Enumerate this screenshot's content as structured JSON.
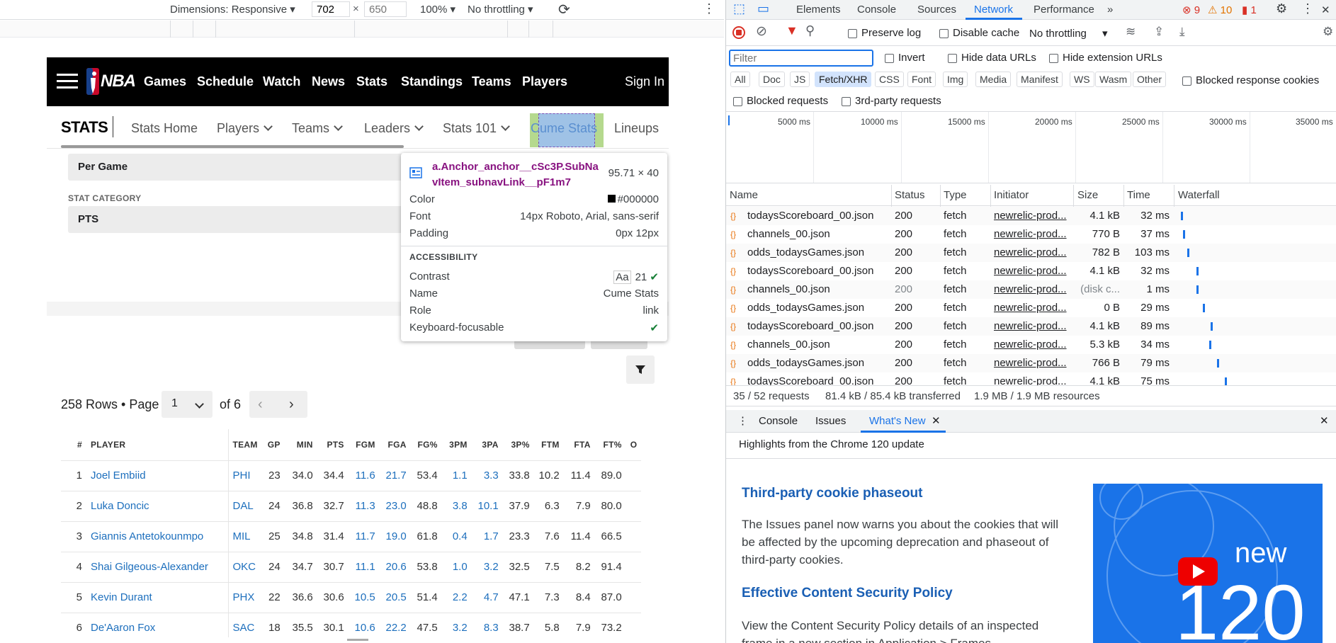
{
  "device_toolbar": {
    "dimensions_label": "Dimensions: Responsive",
    "width": "702",
    "height_placeholder": "650",
    "times": "×",
    "zoom": "100%",
    "throttling": "No throttling"
  },
  "nba": {
    "logo_text": "NBA",
    "nav": [
      "Games",
      "Schedule",
      "Watch",
      "News",
      "Stats",
      "Standings",
      "Teams",
      "Players"
    ],
    "sign_in": "Sign In",
    "stats_label": "STATS",
    "stats_nav": [
      "Stats Home",
      "Players",
      "Teams",
      "Leaders",
      "Stats 101",
      "Cume Stats",
      "Lineups"
    ],
    "per_game": "Per Game",
    "stat_category_label": "STAT CATEGORY",
    "stat_category_value": "PTS",
    "pager": {
      "rows": "258 Rows • Page",
      "page": "1",
      "of": "of 6"
    },
    "table_headers": [
      "#",
      "PLAYER",
      "TEAM",
      "GP",
      "MIN",
      "PTS",
      "FGM",
      "FGA",
      "FG%",
      "3PM",
      "3PA",
      "3P%",
      "FTM",
      "FTA",
      "FT%",
      "O"
    ],
    "rows": [
      [
        "1",
        "Joel Embiid",
        "PHI",
        "23",
        "34.0",
        "34.4",
        "11.6",
        "21.7",
        "53.4",
        "1.1",
        "3.3",
        "33.8",
        "10.2",
        "11.4",
        "89.0"
      ],
      [
        "2",
        "Luka Doncic",
        "DAL",
        "24",
        "36.8",
        "32.7",
        "11.3",
        "23.0",
        "48.8",
        "3.8",
        "10.1",
        "37.9",
        "6.3",
        "7.9",
        "80.0"
      ],
      [
        "3",
        "Giannis Antetokounmpo",
        "MIL",
        "25",
        "34.8",
        "31.4",
        "11.7",
        "19.0",
        "61.8",
        "0.4",
        "1.7",
        "23.3",
        "7.6",
        "11.4",
        "66.5"
      ],
      [
        "4",
        "Shai Gilgeous-Alexander",
        "OKC",
        "24",
        "34.7",
        "30.7",
        "11.1",
        "20.6",
        "53.8",
        "1.0",
        "3.2",
        "32.5",
        "7.5",
        "8.2",
        "91.4"
      ],
      [
        "5",
        "Kevin Durant",
        "PHX",
        "22",
        "36.6",
        "30.6",
        "10.5",
        "20.5",
        "51.4",
        "2.2",
        "4.7",
        "47.1",
        "7.3",
        "8.4",
        "87.0"
      ],
      [
        "6",
        "De'Aaron Fox",
        "SAC",
        "18",
        "35.5",
        "30.1",
        "10.6",
        "22.2",
        "47.5",
        "3.2",
        "8.3",
        "38.7",
        "5.8",
        "7.9",
        "73.2"
      ]
    ]
  },
  "tooltip": {
    "selector": "a.Anchor_anchor__cSc3P.SubNavItem_subnavLink__pF1m7",
    "size": "95.71 × 40",
    "color_label": "Color",
    "color_value": "#000000",
    "font_label": "Font",
    "font_value": "14px Roboto, Arial, sans-serif",
    "padding_label": "Padding",
    "padding_value": "0px 12px",
    "accessibility": "ACCESSIBILITY",
    "contrast_label": "Contrast",
    "contrast_aa": "Aa",
    "contrast_value": "21",
    "name_label": "Name",
    "name_value": "Cume Stats",
    "role_label": "Role",
    "role_value": "link",
    "kbd_label": "Keyboard-focusable"
  },
  "devtools": {
    "tabs": [
      "Elements",
      "Console",
      "Sources",
      "Network",
      "Performance"
    ],
    "errors": "9",
    "warnings": "10",
    "issues": "1",
    "preserve_log": "Preserve log",
    "disable_cache": "Disable cache",
    "throttling": "No throttling",
    "filter_placeholder": "Filter",
    "invert": "Invert",
    "hide_data_urls": "Hide data URLs",
    "hide_ext_urls": "Hide extension URLs",
    "chips": [
      "All",
      "Doc",
      "JS",
      "Fetch/XHR",
      "CSS",
      "Font",
      "Img",
      "Media",
      "Manifest",
      "WS",
      "Wasm",
      "Other"
    ],
    "blocked_cookies": "Blocked response cookies",
    "blocked_requests": "Blocked requests",
    "third_party": "3rd-party requests",
    "timeline": [
      "5000 ms",
      "10000 ms",
      "15000 ms",
      "20000 ms",
      "25000 ms",
      "30000 ms",
      "35000 ms"
    ],
    "columns": [
      "Name",
      "Status",
      "Type",
      "Initiator",
      "Size",
      "Time",
      "Waterfall"
    ],
    "requests": [
      {
        "name": "todaysScoreboard_00.json",
        "status": "200",
        "type": "fetch",
        "initiator": "newrelic-prod...",
        "size": "4.1 kB",
        "time": "32 ms",
        "wf": 0.02
      },
      {
        "name": "channels_00.json",
        "status": "200",
        "type": "fetch",
        "initiator": "newrelic-prod...",
        "size": "770 B",
        "time": "37 ms",
        "wf": 0.03
      },
      {
        "name": "odds_todaysGames.json",
        "status": "200",
        "type": "fetch",
        "initiator": "newrelic-prod...",
        "size": "782 B",
        "time": "103 ms",
        "wf": 0.06
      },
      {
        "name": "todaysScoreboard_00.json",
        "status": "200",
        "type": "fetch",
        "initiator": "newrelic-prod...",
        "size": "4.1 kB",
        "time": "32 ms",
        "wf": 0.12
      },
      {
        "name": "channels_00.json",
        "status": "200",
        "type": "fetch",
        "initiator": "newrelic-prod...",
        "size": "(disk c...",
        "time": "1 ms",
        "wf": 0.12
      },
      {
        "name": "odds_todaysGames.json",
        "status": "200",
        "type": "fetch",
        "initiator": "newrelic-prod...",
        "size": "0 B",
        "time": "29 ms",
        "wf": 0.16
      },
      {
        "name": "todaysScoreboard_00.json",
        "status": "200",
        "type": "fetch",
        "initiator": "newrelic-prod...",
        "size": "4.1 kB",
        "time": "89 ms",
        "wf": 0.21
      },
      {
        "name": "channels_00.json",
        "status": "200",
        "type": "fetch",
        "initiator": "newrelic-prod...",
        "size": "5.3 kB",
        "time": "34 ms",
        "wf": 0.2
      },
      {
        "name": "odds_todaysGames.json",
        "status": "200",
        "type": "fetch",
        "initiator": "newrelic-prod...",
        "size": "766 B",
        "time": "79 ms",
        "wf": 0.25
      },
      {
        "name": "todaysScoreboard_00.json",
        "status": "200",
        "type": "fetch",
        "initiator": "newrelic-prod...",
        "size": "4.1 kB",
        "time": "75 ms",
        "wf": 0.3
      }
    ],
    "summary": {
      "requests": "35 / 52 requests",
      "transferred": "81.4 kB / 85.4 kB transferred",
      "resources": "1.9 MB / 1.9 MB resources"
    },
    "drawer_tabs": [
      "Console",
      "Issues",
      "What's New"
    ],
    "whats_new": {
      "header": "Highlights from the Chrome 120 update",
      "h1": "Third-party cookie phaseout",
      "p1": "The Issues panel now warns you about the cookies that will be affected by the upcoming deprecation and phaseout of third-party cookies.",
      "h2": "Effective Content Security Policy",
      "p2": "View the Content Security Policy details of an inspected frame in a new section in Application > Frames.",
      "promo_new": "new",
      "promo_num": "120"
    }
  }
}
